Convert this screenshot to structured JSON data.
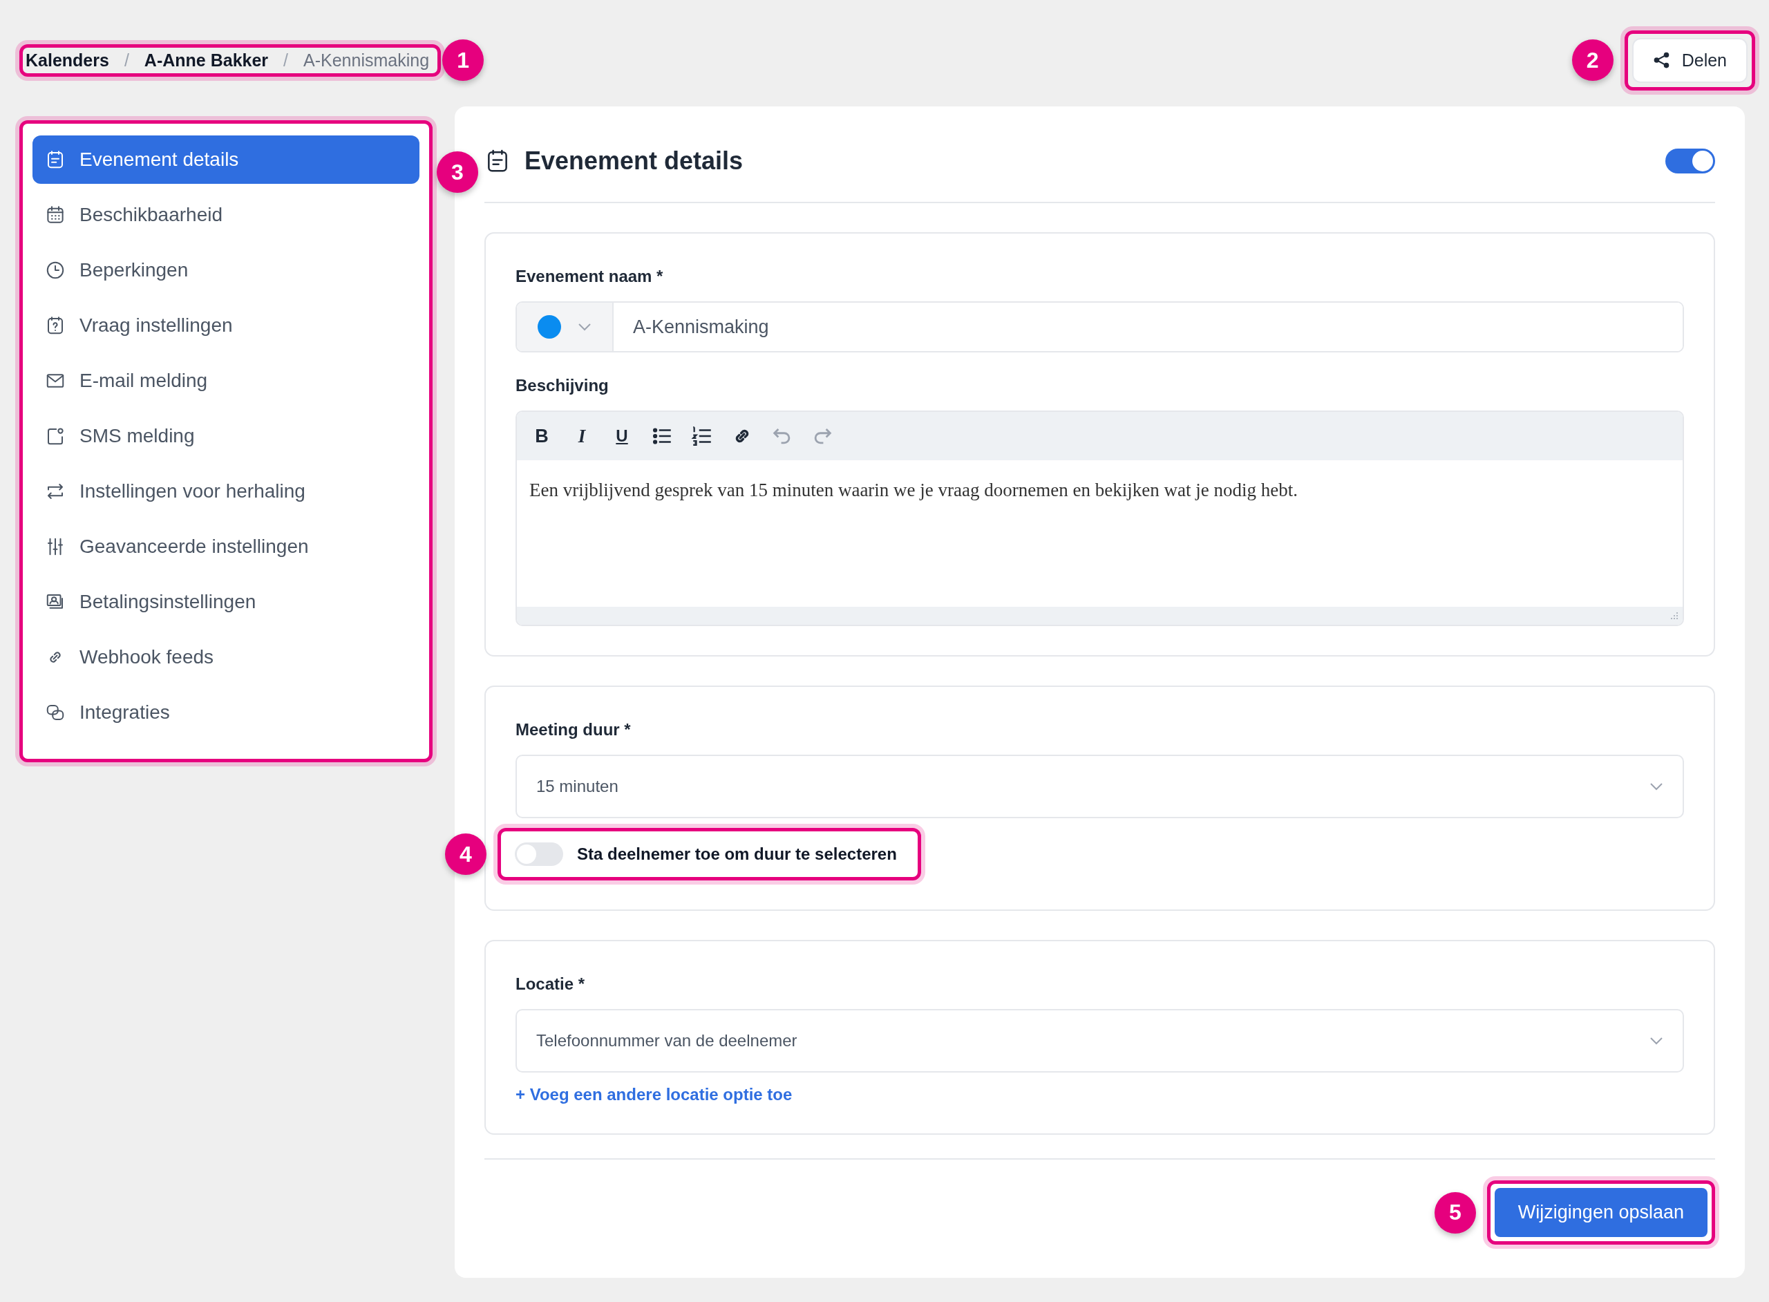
{
  "breadcrumb": {
    "callout": "1",
    "separator": "/",
    "items": [
      {
        "label": "Kalenders",
        "current": false
      },
      {
        "label": "A-Anne Bakker",
        "current": false
      },
      {
        "label": "A-Kennismaking",
        "current": true
      }
    ]
  },
  "share_button": {
    "label": "Delen",
    "callout": "2"
  },
  "sidebar": {
    "callout": "3",
    "items": [
      {
        "label": "Evenement details",
        "selected": true
      },
      {
        "label": "Beschikbaarheid",
        "selected": false
      },
      {
        "label": "Beperkingen",
        "selected": false
      },
      {
        "label": "Vraag instellingen",
        "selected": false
      },
      {
        "label": "E-mail melding",
        "selected": false
      },
      {
        "label": "SMS melding",
        "selected": false
      },
      {
        "label": "Instellingen voor herhaling",
        "selected": false
      },
      {
        "label": "Geavanceerde instellingen",
        "selected": false
      },
      {
        "label": "Betalingsinstellingen",
        "selected": false
      },
      {
        "label": "Webhook feeds",
        "selected": false
      },
      {
        "label": "Integraties",
        "selected": false
      }
    ]
  },
  "header": {
    "title": "Evenement details",
    "enabled": true
  },
  "event_name": {
    "label": "Evenement naam *",
    "color": "#0a8cf0",
    "value": "A-Kennismaking"
  },
  "description": {
    "label": "Beschijving",
    "toolbar": [
      "B",
      "I",
      "U"
    ],
    "text": "Een vrijblijvend gesprek van 15 minuten waarin we je vraag doornemen en bekijken wat je nodig hebt."
  },
  "duration": {
    "label": "Meeting duur *",
    "value": "15 minuten",
    "toggle": {
      "label": "Sta deelnemer toe om duur te selecteren",
      "on": false,
      "callout": "4"
    }
  },
  "location": {
    "label": "Locatie *",
    "value": "Telefoonnummer van de deelnemer",
    "add_link": "+ Voeg een andere locatie optie toe"
  },
  "save_button": {
    "label": "Wijzigingen opslaan",
    "callout": "5"
  }
}
